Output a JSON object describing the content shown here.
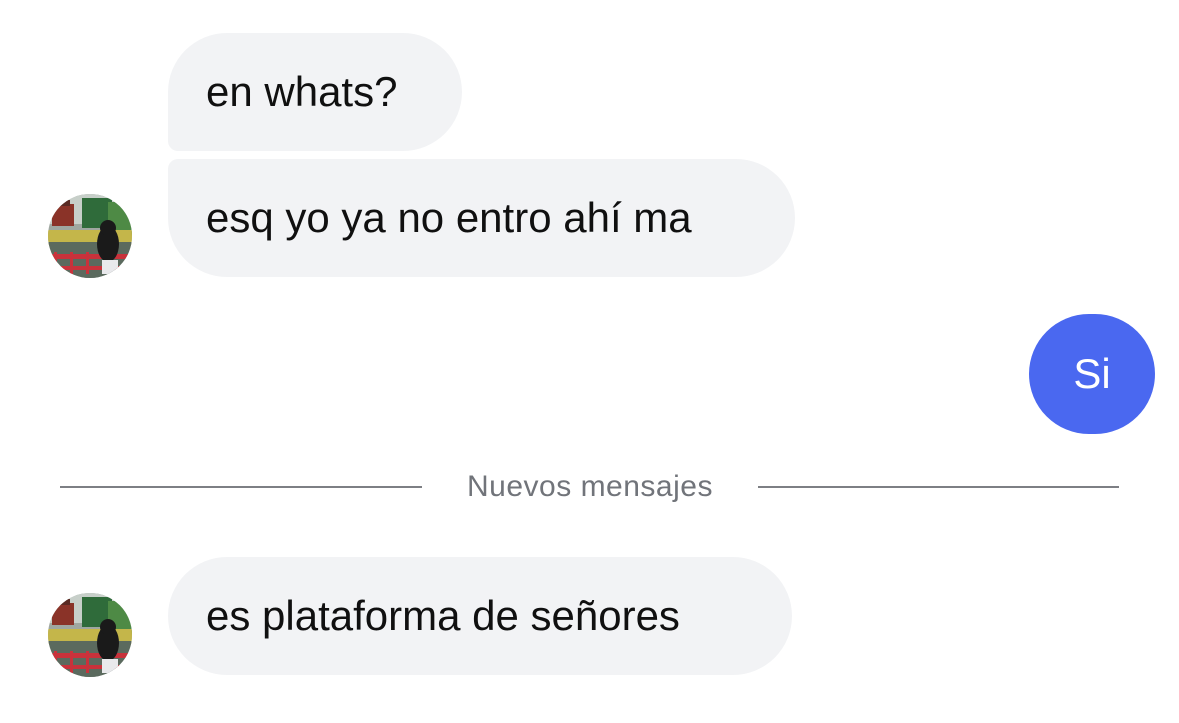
{
  "messages": [
    {
      "id": "m1",
      "direction": "incoming",
      "text": "en whats?"
    },
    {
      "id": "m2",
      "direction": "incoming",
      "text": "esq yo ya no entro ahí ma"
    },
    {
      "id": "m3",
      "direction": "outgoing",
      "text": "Si"
    },
    {
      "id": "m4",
      "direction": "incoming",
      "text": "es plataforma de señores"
    }
  ],
  "divider": {
    "label": "Nuevos mensajes"
  },
  "colors": {
    "incoming_bubble": "#f2f3f5",
    "outgoing_bubble": "#4a68f0",
    "divider_line": "#7d7f84",
    "divider_text": "#71747a"
  },
  "icons": {
    "contact_avatar": "avatar"
  }
}
